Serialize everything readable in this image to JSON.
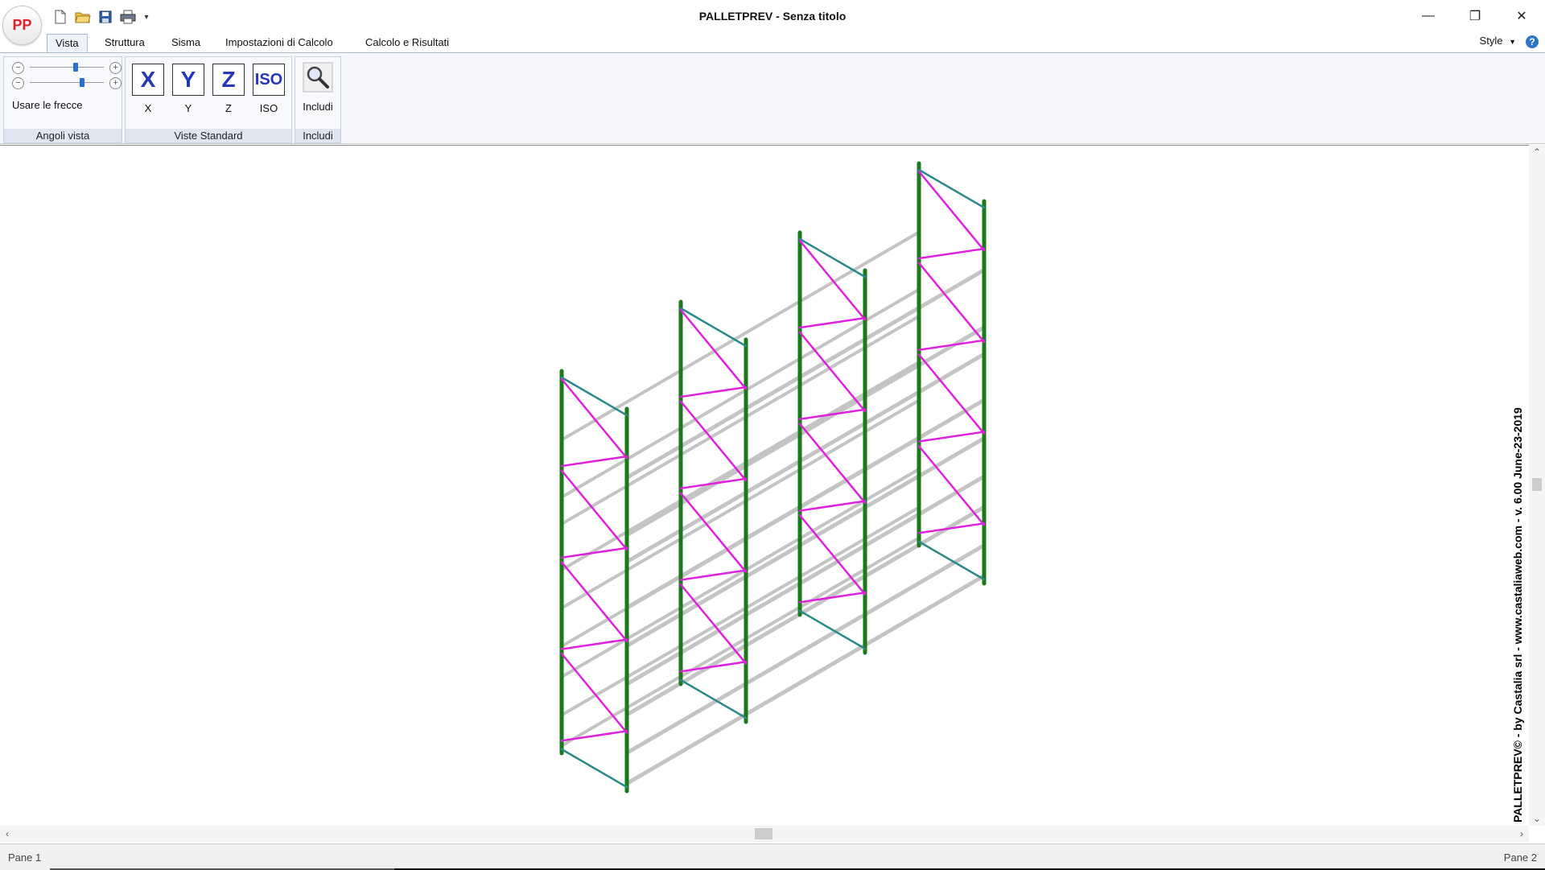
{
  "app": {
    "logo_text": "PP",
    "title": "PALLETPREV - Senza titolo"
  },
  "quick_access": {
    "icons": [
      "new-file-icon",
      "open-folder-icon",
      "save-icon",
      "print-icon",
      "customize-dropdown-icon"
    ]
  },
  "window_controls": {
    "minimize": "—",
    "restore": "❐",
    "close": "✕"
  },
  "tabs": [
    {
      "label": "Vista",
      "active": true
    },
    {
      "label": "Struttura",
      "active": false
    },
    {
      "label": "Sisma",
      "active": false
    },
    {
      "label": "Impostazioni di Calcolo",
      "active": false
    },
    {
      "label": "Calcolo e Risultati",
      "active": false
    }
  ],
  "style_menu": "Style",
  "help_glyph": "?",
  "ribbon": {
    "angoli_vista": {
      "label": "Angoli vista",
      "slider1_value": 0.62,
      "slider2_value": 0.71,
      "minus_glyph": "−",
      "plus_glyph": "+",
      "arrows_label": "Usare le frecce"
    },
    "viste_standard": {
      "label": "Viste Standard",
      "buttons": [
        {
          "glyph": "X",
          "caption": "X"
        },
        {
          "glyph": "Y",
          "caption": "Y"
        },
        {
          "glyph": "Z",
          "caption": "Z"
        },
        {
          "glyph": "ISO",
          "caption": "ISO"
        }
      ]
    },
    "includi": {
      "label": "Includi",
      "button_caption": "Includi"
    }
  },
  "viewport": {
    "watermark": "PALLETPREV© - by Castalia srl - www.castaliaweb.com - v. 6.00 June-23-2019",
    "colors": {
      "upright": "#1a7a1a",
      "bracing": "#e020e0",
      "frame_end": "#2a8a8a",
      "beam": "#c4c4c4"
    }
  },
  "scroll": {
    "up": "⌃",
    "down": "⌄",
    "left": "‹",
    "right": "›"
  },
  "status": {
    "pane1": "Pane 1",
    "pane2": "Pane 2"
  }
}
